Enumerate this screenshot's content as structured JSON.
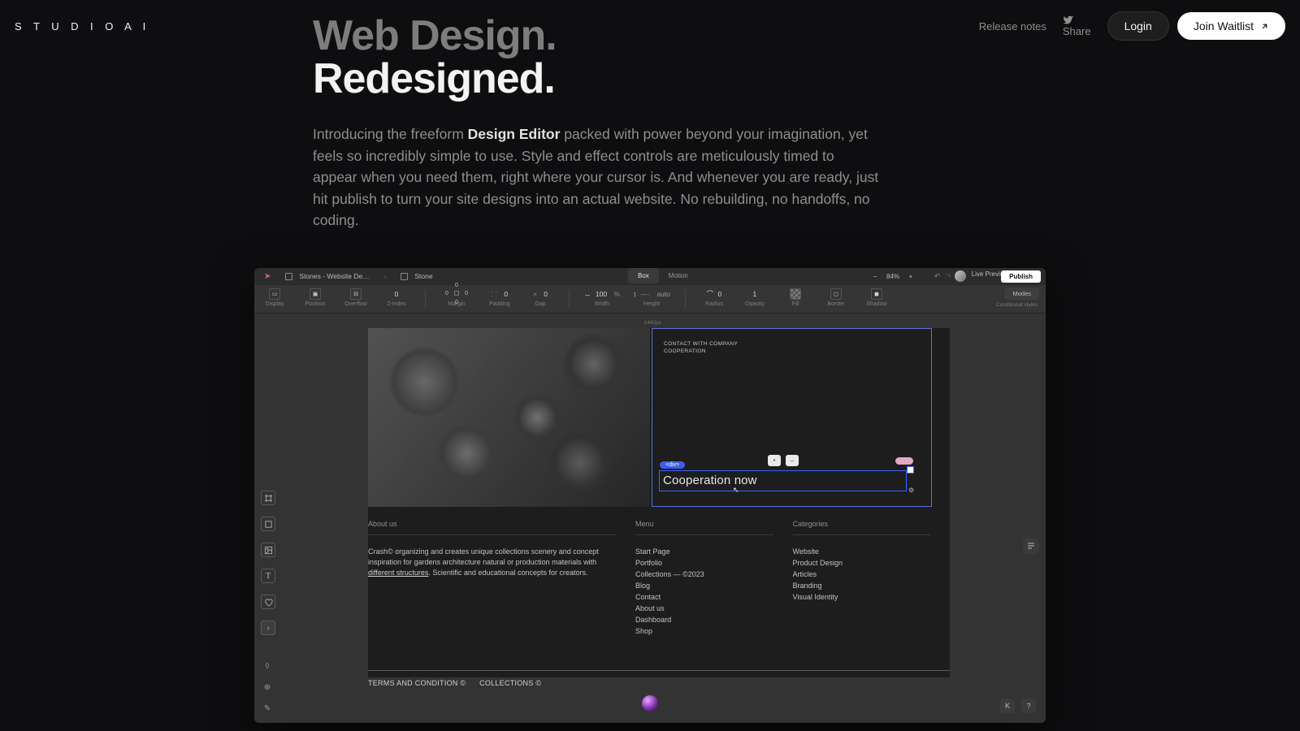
{
  "site": {
    "logo": "S T U D I O  A I",
    "release_notes": "Release notes",
    "share": "Share",
    "login": "Login",
    "join": "Join Waitlist"
  },
  "hero": {
    "line1": "Web Design.",
    "line2": "Redesigned.",
    "body_pre": "Introducing the freeform ",
    "body_bold": "Design Editor",
    "body_post": " packed with power beyond your imagination, yet feels so incredibly simple to use. Style and effect controls are meticulously timed to appear when you need them, right where your cursor is. And whenever you are ready, just hit publish to turn your site designs into an actual website. No rebuilding, no handoffs, no coding."
  },
  "editor": {
    "crumb_project": "Stones - Website De…",
    "crumb_page": "Stone",
    "tab_box": "Box",
    "tab_motion": "Motion",
    "zoom_minus": "−",
    "zoom_val": "84%",
    "zoom_plus": "+",
    "undo": "↶",
    "redo": "↷",
    "live_preview": "Live Preview",
    "publish": "Publish",
    "modes": "Modes",
    "conditional": "Conditional styles",
    "ruler": "1440px"
  },
  "props": {
    "display": "Display",
    "position": "Position",
    "overflow": "Overflow",
    "zindex_lbl": "Z-index",
    "zindex_val": "0",
    "margin": "Margin",
    "margin_t": "0",
    "margin_b": "0",
    "margin_l": "0",
    "margin_r": "0",
    "padding": "Padding",
    "padding_val": "0",
    "gap": "Gap",
    "gap_val": "0",
    "width": "Width",
    "width_val": "100",
    "width_unit": "%",
    "height": "Height",
    "height_val": "auto",
    "radius": "Radius",
    "radius_val": "0",
    "opacity": "Opacity",
    "opacity_val": "1",
    "fill": "Fill",
    "border": "Border",
    "shadow": "Shadow"
  },
  "card": {
    "line1": "CONTACT WITH COMPANY",
    "line2": "COOPERATION",
    "sel_tag": "<div>",
    "sel_text": "Cooperation now"
  },
  "footer": {
    "col1_h": "About us",
    "col1_body_pre": "Crash© organizing and creates unique collections scenery and concept inspiration for gardens architecture natural or production materials with ",
    "col1_body_link": "different structures",
    "col1_body_post": ". Scientific and educational concepts for creators.",
    "col2_h": "Menu",
    "col2_items": [
      "Start Page",
      "Portfolio",
      "Collections  —  ©2023",
      "Blog",
      "Contact",
      "About us",
      "Dashboard",
      "Shop"
    ],
    "col3_h": "Categories",
    "col3_items": [
      "Website",
      "Product Design",
      "Articles",
      "Branding",
      "Visual Identity"
    ],
    "legal1": "TERMS AND CONDITION ©",
    "legal2": "COLLECTIONS ©"
  },
  "tools": {
    "frame": "frame",
    "rect": "rect",
    "image": "image",
    "text": "text",
    "heart": "heart",
    "more": "more",
    "bookmark": "bookmark",
    "globe": "globe",
    "pen": "pen",
    "layers": "layers",
    "kbd": "K",
    "help": "?"
  }
}
